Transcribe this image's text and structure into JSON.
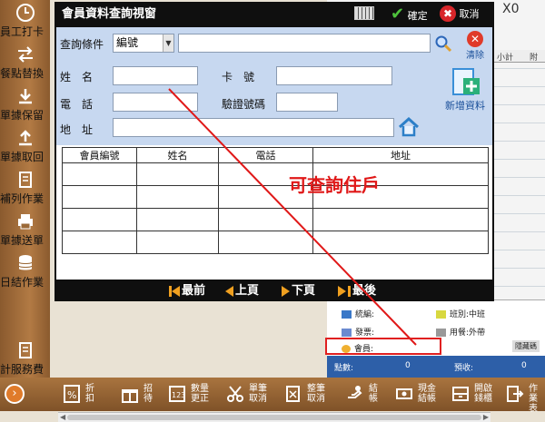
{
  "sidebar": {
    "items": [
      {
        "label": "員工打卡",
        "icon": "clock-icon"
      },
      {
        "label": "餐點替換",
        "icon": "swap-icon"
      },
      {
        "label": "單據保留",
        "icon": "download-icon"
      },
      {
        "label": "單據取回",
        "icon": "upload-icon"
      },
      {
        "label": "補列作業",
        "icon": "document-icon"
      },
      {
        "label": "單據送單",
        "icon": "printer-icon"
      },
      {
        "label": "日結作業",
        "icon": "database-icon"
      },
      {
        "label": "計服務費",
        "icon": "receipt-icon"
      }
    ]
  },
  "bottombar": {
    "buttons": [
      {
        "label": "折扣",
        "icon": "percent-icon"
      },
      {
        "label": "招待",
        "icon": "gift-icon"
      },
      {
        "label": "數量更正",
        "icon": "quantity-edit-icon"
      },
      {
        "label": "單筆取消",
        "icon": "scissors-icon"
      },
      {
        "label": "整筆取消",
        "icon": "cancel-document-icon"
      },
      {
        "label": "結帳",
        "icon": "checkout-icon"
      },
      {
        "label": "現金結帳",
        "icon": "cash-icon"
      },
      {
        "label": "開啟錢櫃",
        "icon": "drawer-icon"
      },
      {
        "label": "作業表",
        "icon": "exit-icon"
      }
    ]
  },
  "background": {
    "x0": "X0",
    "col_subtotal": "小計",
    "col_extra": "附",
    "info": {
      "tax_id": "統編:",
      "shift": "班別:中班",
      "invoice": "發票:",
      "dining": "用餐:外帶",
      "member": "會員:",
      "points": "點數:",
      "points_value": "0",
      "prepaid": "預收:",
      "prepaid_value": "0",
      "hidden_btn": "隱藏碼"
    }
  },
  "dialog": {
    "title": "會員資料查詢視窗",
    "confirm_label": "確定",
    "cancel_label": "取消",
    "query_label": "查詢條件",
    "query_value": "編號",
    "clear_label": "清除",
    "fields": {
      "name": "姓　名",
      "card_no": "卡　號",
      "phone": "電　話",
      "verify_code": "驗證號碼",
      "address": "地　址"
    },
    "add_label": "新增資料",
    "table": {
      "headers": [
        "會員編號",
        "姓名",
        "電話",
        "地址"
      ],
      "rows": [
        [
          "",
          "",
          "",
          ""
        ],
        [
          "",
          "",
          "",
          ""
        ],
        [
          "",
          "",
          "",
          ""
        ],
        [
          "",
          "",
          "",
          ""
        ]
      ]
    },
    "nav": {
      "first": "最前",
      "prev": "上頁",
      "next": "下頁",
      "last": "最後"
    }
  },
  "annotation": "可查詢住戶",
  "colors": {
    "sidebar": "#9b6a38",
    "form_bg": "#c7d8f0",
    "annotation": "#e01818",
    "dialog_frame": "#0f0f0f"
  }
}
